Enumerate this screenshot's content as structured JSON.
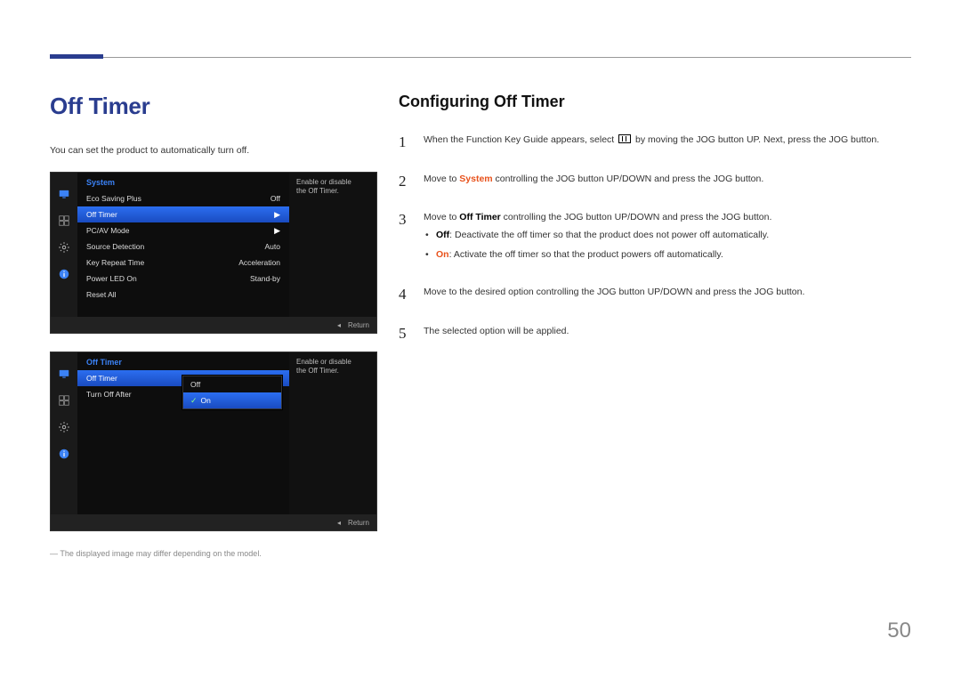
{
  "page": {
    "title": "Off Timer",
    "intro": "You can set the product to automatically turn off.",
    "footnote": "― The displayed image may differ depending on the model.",
    "pageNumber": "50",
    "section": "Configuring Off Timer"
  },
  "osd1": {
    "title": "System",
    "help_line1": "Enable or disable",
    "help_line2": "the Off Timer.",
    "return": "Return",
    "rows": [
      {
        "label": "Eco Saving Plus",
        "value": "Off",
        "hl": false
      },
      {
        "label": "Off Timer",
        "value": "▶",
        "hl": true
      },
      {
        "label": "PC/AV Mode",
        "value": "▶",
        "hl": false
      },
      {
        "label": "Source Detection",
        "value": "Auto",
        "hl": false
      },
      {
        "label": "Key Repeat Time",
        "value": "Acceleration",
        "hl": false
      },
      {
        "label": "Power LED On",
        "value": "Stand-by",
        "hl": false
      },
      {
        "label": "Reset All",
        "value": "",
        "hl": false
      }
    ]
  },
  "osd2": {
    "title": "Off Timer",
    "help_line1": "Enable or disable",
    "help_line2": "the Off Timer.",
    "return": "Return",
    "rows": [
      {
        "label": "Off Timer",
        "value": "Off",
        "hl": true
      },
      {
        "label": "Turn Off After",
        "value": "",
        "hl": false
      }
    ],
    "popup": [
      {
        "label": "Off",
        "checked": false,
        "hl": false
      },
      {
        "label": "On",
        "checked": true,
        "hl": true
      }
    ]
  },
  "steps": {
    "s1a": "When the Function Key Guide appears, select ",
    "s1b": " by moving the JOG button UP. Next, press the JOG button.",
    "s2a": "Move to ",
    "s2b_system": "System",
    "s2c": " controlling the JOG button UP/DOWN and press the JOG button.",
    "s3a": "Move to ",
    "s3b_off": "Off Timer",
    "s3c": " controlling the JOG button UP/DOWN and press the JOG button.",
    "bullet_off_label": "Off",
    "bullet_off_text": ": Deactivate the off timer so that the product does not power off automatically.",
    "bullet_on_label": "On",
    "bullet_on_text": ": Activate the off timer so that the product powers off automatically.",
    "s4": "Move to the desired option controlling the JOG button UP/DOWN and press the JOG button.",
    "s5": "The selected option will be applied.",
    "n1": "1",
    "n2": "2",
    "n3": "3",
    "n4": "4",
    "n5": "5"
  }
}
